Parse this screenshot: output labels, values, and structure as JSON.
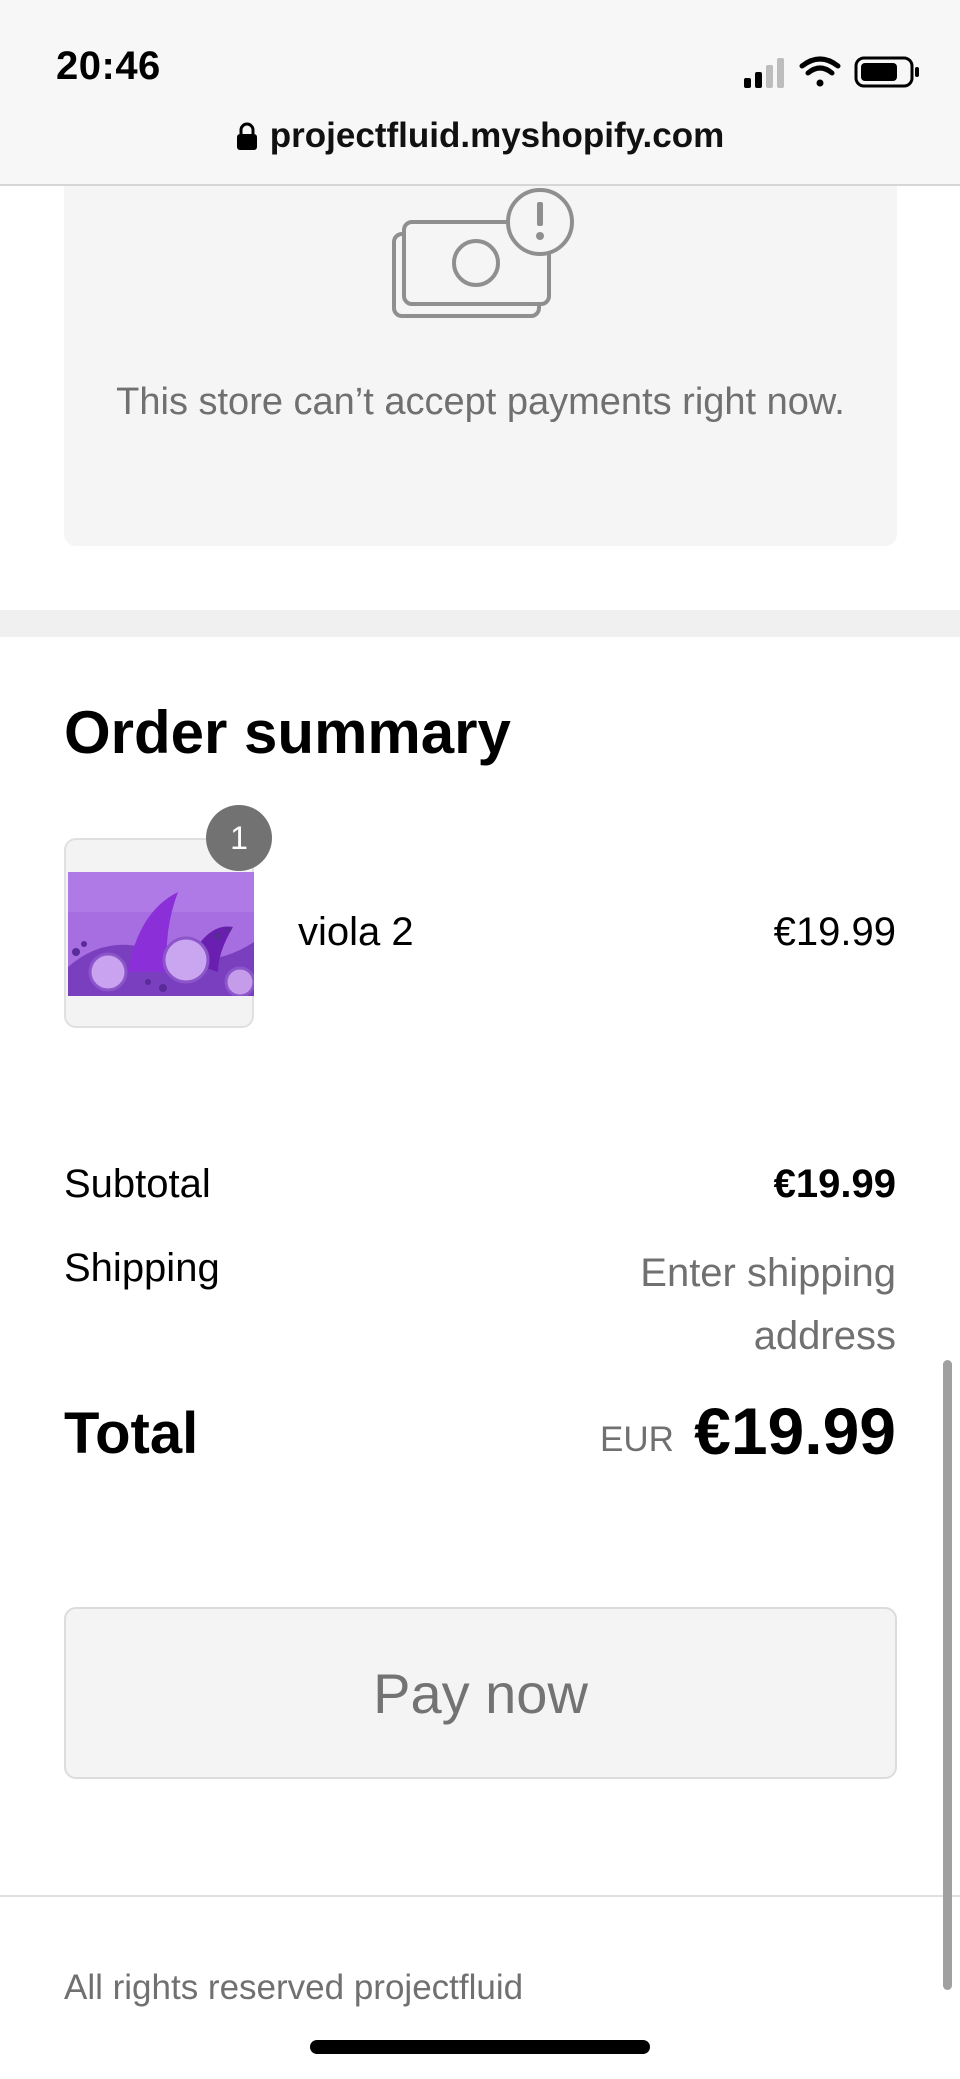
{
  "status_bar": {
    "time": "20:46",
    "url": "projectfluid.myshopify.com"
  },
  "payment_notice": {
    "icon": "payment-unavailable-icon",
    "message": "This store can’t accept payments right now."
  },
  "order_summary": {
    "title": "Order summary",
    "items": [
      {
        "name": "viola 2",
        "price": "€19.99",
        "quantity": "1"
      }
    ],
    "subtotal_label": "Subtotal",
    "subtotal_value": "€19.99",
    "shipping_label": "Shipping",
    "shipping_value": "Enter shipping address",
    "total_label": "Total",
    "total_currency": "EUR",
    "total_value": "€19.99"
  },
  "pay_button_label": "Pay now",
  "footer": {
    "text": "All rights reserved projectfluid"
  },
  "colors": {
    "status_bar_bg": "#f7f7f7",
    "notice_bg": "#f5f5f5",
    "muted_text": "#707070",
    "badge_bg": "#727272",
    "product_purple": "#9a5fd6"
  }
}
